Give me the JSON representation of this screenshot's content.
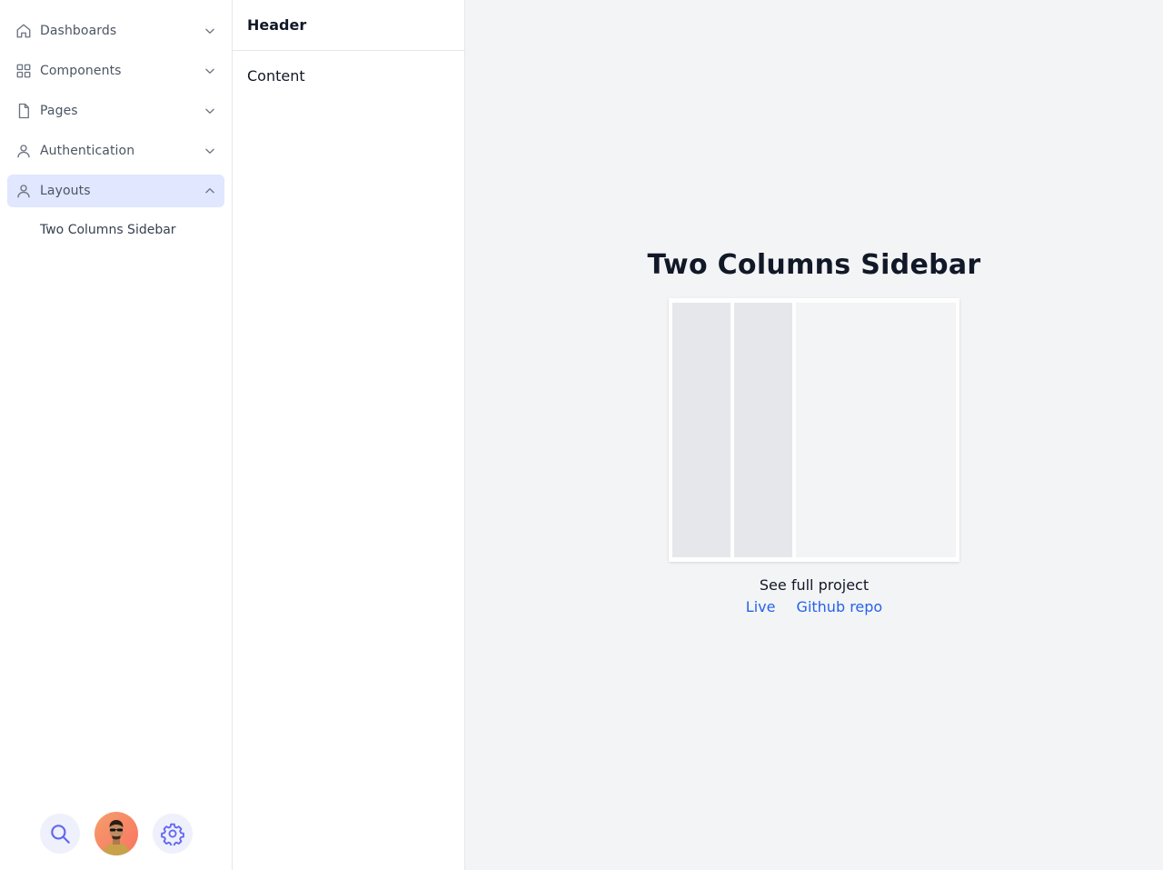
{
  "sidebar": {
    "items": [
      {
        "label": "Dashboards",
        "icon": "home-icon",
        "expanded": false
      },
      {
        "label": "Components",
        "icon": "grid-icon",
        "expanded": false
      },
      {
        "label": "Pages",
        "icon": "file-icon",
        "expanded": false
      },
      {
        "label": "Authentication",
        "icon": "user-icon",
        "expanded": false
      },
      {
        "label": "Layouts",
        "icon": "user-icon",
        "expanded": true
      }
    ],
    "sub_items": [
      {
        "label": "Two Columns Sidebar"
      }
    ],
    "bottom": {
      "search_icon": "search-icon",
      "avatar": "avatar",
      "settings_icon": "gear-icon"
    }
  },
  "column": {
    "header": "Header",
    "content": "Content"
  },
  "main": {
    "title": "Two Columns Sidebar",
    "see_full": "See full project",
    "live_link": "Live",
    "github_link": "Github repo"
  },
  "colors": {
    "accent": "#e0e7ff",
    "link": "#2563eb",
    "background": "#f3f4f6"
  }
}
